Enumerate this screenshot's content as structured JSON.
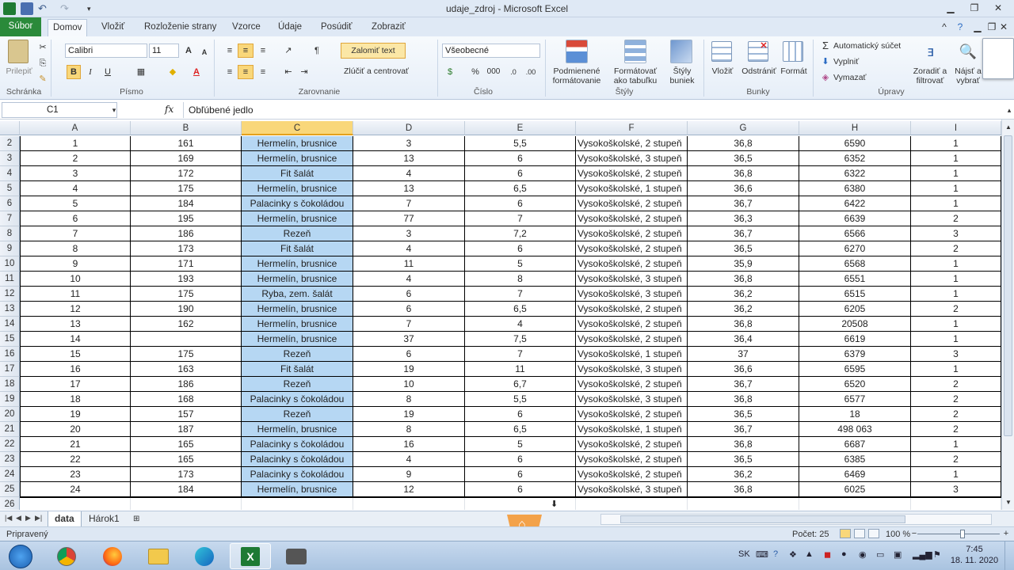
{
  "window": {
    "title": "udaje_zdroj  -  Microsoft Excel"
  },
  "ribbon": {
    "tabs": [
      "Súbor",
      "Domov",
      "Vložiť",
      "Rozloženie strany",
      "Vzorce",
      "Údaje",
      "Posúdiť",
      "Zobraziť"
    ],
    "groups": {
      "clipboard": "Schránka",
      "font": "Písmo",
      "alignment": "Zarovnanie",
      "number": "Číslo",
      "styles": "Štýly",
      "cells": "Bunky",
      "editing": "Úpravy"
    },
    "paste_label": "Prilepiť",
    "font_name": "Calibri",
    "font_size": "11",
    "wrap_text": "Zalomiť text",
    "merge_center": "Zlúčiť a centrovať",
    "number_format": "Všeobecné",
    "cond_format": [
      "Podmienené",
      "formátovanie"
    ],
    "format_table": [
      "Formátovať",
      "ako tabuľku"
    ],
    "cell_styles": [
      "Štýly",
      "buniek"
    ],
    "insert": "Vložiť",
    "delete": "Odstrániť",
    "format": "Formát",
    "autosum": "Automatický súčet",
    "fill": "Vyplniť",
    "clear": "Vymazať",
    "sort_filter": [
      "Zoradiť a",
      "filtrovať"
    ],
    "find_select": [
      "Nájsť a",
      "vybrať"
    ],
    "bold": "B",
    "italic": "I",
    "underline": "U",
    "percent": "%",
    "thousands": "000"
  },
  "formula_bar": {
    "name_box": "C1",
    "fx": "fx",
    "content": "Obľúbené jedlo"
  },
  "columns": [
    "A",
    "B",
    "C",
    "D",
    "E",
    "F",
    "G",
    "H",
    "I"
  ],
  "rows": [
    {
      "n": "2",
      "cells": [
        "1",
        "161",
        "Hermelín, brusnice",
        "3",
        "5,5",
        "Vysokoškolské, 2 stupeň",
        "36,8",
        "6590",
        "1"
      ]
    },
    {
      "n": "3",
      "cells": [
        "2",
        "169",
        "Hermelín, brusnice",
        "13",
        "6",
        "Vysokoškolské, 3 stupeň",
        "36,5",
        "6352",
        "1"
      ]
    },
    {
      "n": "4",
      "cells": [
        "3",
        "172",
        "Fit šalát",
        "4",
        "6",
        "Vysokoškolské, 2 stupeň",
        "36,8",
        "6322",
        "1"
      ]
    },
    {
      "n": "5",
      "cells": [
        "4",
        "175",
        "Hermelín, brusnice",
        "13",
        "6,5",
        "Vysokoškolské, 1 stupeň",
        "36,6",
        "6380",
        "1"
      ]
    },
    {
      "n": "6",
      "cells": [
        "5",
        "184",
        "Palacinky s čokoládou",
        "7",
        "6",
        "Vysokoškolské, 2 stupeň",
        "36,7",
        "6422",
        "1"
      ]
    },
    {
      "n": "7",
      "cells": [
        "6",
        "195",
        "Hermelín, brusnice",
        "77",
        "7",
        "Vysokoškolské, 2 stupeň",
        "36,3",
        "6639",
        "2"
      ]
    },
    {
      "n": "8",
      "cells": [
        "7",
        "186",
        "Rezeň",
        "3",
        "7,2",
        "Vysokoškolské, 2 stupeň",
        "36,7",
        "6566",
        "3"
      ]
    },
    {
      "n": "9",
      "cells": [
        "8",
        "173",
        "Fit šalát",
        "4",
        "6",
        "Vysokoškolské, 2 stupeň",
        "36,5",
        "6270",
        "2"
      ]
    },
    {
      "n": "10",
      "cells": [
        "9",
        "171",
        "Hermelín, brusnice",
        "11",
        "5",
        "Vysokoškolské, 2 stupeň",
        "35,9",
        "6568",
        "1"
      ]
    },
    {
      "n": "11",
      "cells": [
        "10",
        "193",
        "Hermelín, brusnice",
        "4",
        "8",
        "Vysokoškolské, 3 stupeň",
        "36,8",
        "6551",
        "1"
      ]
    },
    {
      "n": "12",
      "cells": [
        "11",
        "175",
        "Ryba, zem. šalát",
        "6",
        "7",
        "Vysokoškolské, 3 stupeň",
        "36,2",
        "6515",
        "1"
      ]
    },
    {
      "n": "13",
      "cells": [
        "12",
        "190",
        "Hermelín, brusnice",
        "6",
        "6,5",
        "Vysokoškolské, 2 stupeň",
        "36,2",
        "6205",
        "2"
      ]
    },
    {
      "n": "14",
      "cells": [
        "13",
        "162",
        "Hermelín, brusnice",
        "7",
        "4",
        "Vysokoškolské, 2 stupeň",
        "36,8",
        "20508",
        "1"
      ]
    },
    {
      "n": "15",
      "cells": [
        "14",
        "",
        "Hermelín, brusnice",
        "37",
        "7,5",
        "Vysokoškolské, 2 stupeň",
        "36,4",
        "6619",
        "1"
      ]
    },
    {
      "n": "16",
      "cells": [
        "15",
        "175",
        "Rezeň",
        "6",
        "7",
        "Vysokoškolské, 1 stupeň",
        "37",
        "6379",
        "3"
      ]
    },
    {
      "n": "17",
      "cells": [
        "16",
        "163",
        "Fit šalát",
        "19",
        "11",
        "Vysokoškolské, 3 stupeň",
        "36,6",
        "6595",
        "1"
      ]
    },
    {
      "n": "18",
      "cells": [
        "17",
        "186",
        "Rezeň",
        "10",
        "6,7",
        "Vysokoškolské, 2 stupeň",
        "36,7",
        "6520",
        "2"
      ]
    },
    {
      "n": "19",
      "cells": [
        "18",
        "168",
        "Palacinky s čokoládou",
        "8",
        "5,5",
        "Vysokoškolské, 3 stupeň",
        "36,8",
        "6577",
        "2"
      ]
    },
    {
      "n": "20",
      "cells": [
        "19",
        "157",
        "Rezeň",
        "19",
        "6",
        "Vysokoškolské, 2 stupeň",
        "36,5",
        "18",
        "2"
      ]
    },
    {
      "n": "21",
      "cells": [
        "20",
        "187",
        "Hermelín, brusnice",
        "8",
        "6,5",
        "Vysokoškolské, 1 stupeň",
        "36,7",
        "498 063",
        "2"
      ]
    },
    {
      "n": "22",
      "cells": [
        "21",
        "165",
        "Palacinky s čokoládou",
        "16",
        "5",
        "Vysokoškolské, 2 stupeň",
        "36,8",
        "6687",
        "1"
      ]
    },
    {
      "n": "23",
      "cells": [
        "22",
        "165",
        "Palacinky s čokoládou",
        "4",
        "6",
        "Vysokoškolské, 2 stupeň",
        "36,5",
        "6385",
        "2"
      ]
    },
    {
      "n": "24",
      "cells": [
        "23",
        "173",
        "Palacinky s čokoládou",
        "9",
        "6",
        "Vysokoškolské, 2 stupeň",
        "36,2",
        "6469",
        "1"
      ]
    },
    {
      "n": "25",
      "cells": [
        "24",
        "184",
        "Hermelín, brusnice",
        "12",
        "6",
        "Vysokoškolské, 3 stupeň",
        "36,8",
        "6025",
        "3"
      ]
    }
  ],
  "empty_row": "26",
  "sheets": {
    "tabs": [
      "data",
      "Hárok1"
    ],
    "active": "data"
  },
  "status": {
    "ready": "Pripravený",
    "count": "Počet: 25",
    "zoom": "100 %"
  },
  "taskbar": {
    "lang": "SK",
    "time": "7:45",
    "date": "18. 11. 2020"
  },
  "colors": {
    "selected_column": "#b6d7f3",
    "file_tab": "#2a8a3a",
    "col_header_selected": "#f9d77a"
  }
}
